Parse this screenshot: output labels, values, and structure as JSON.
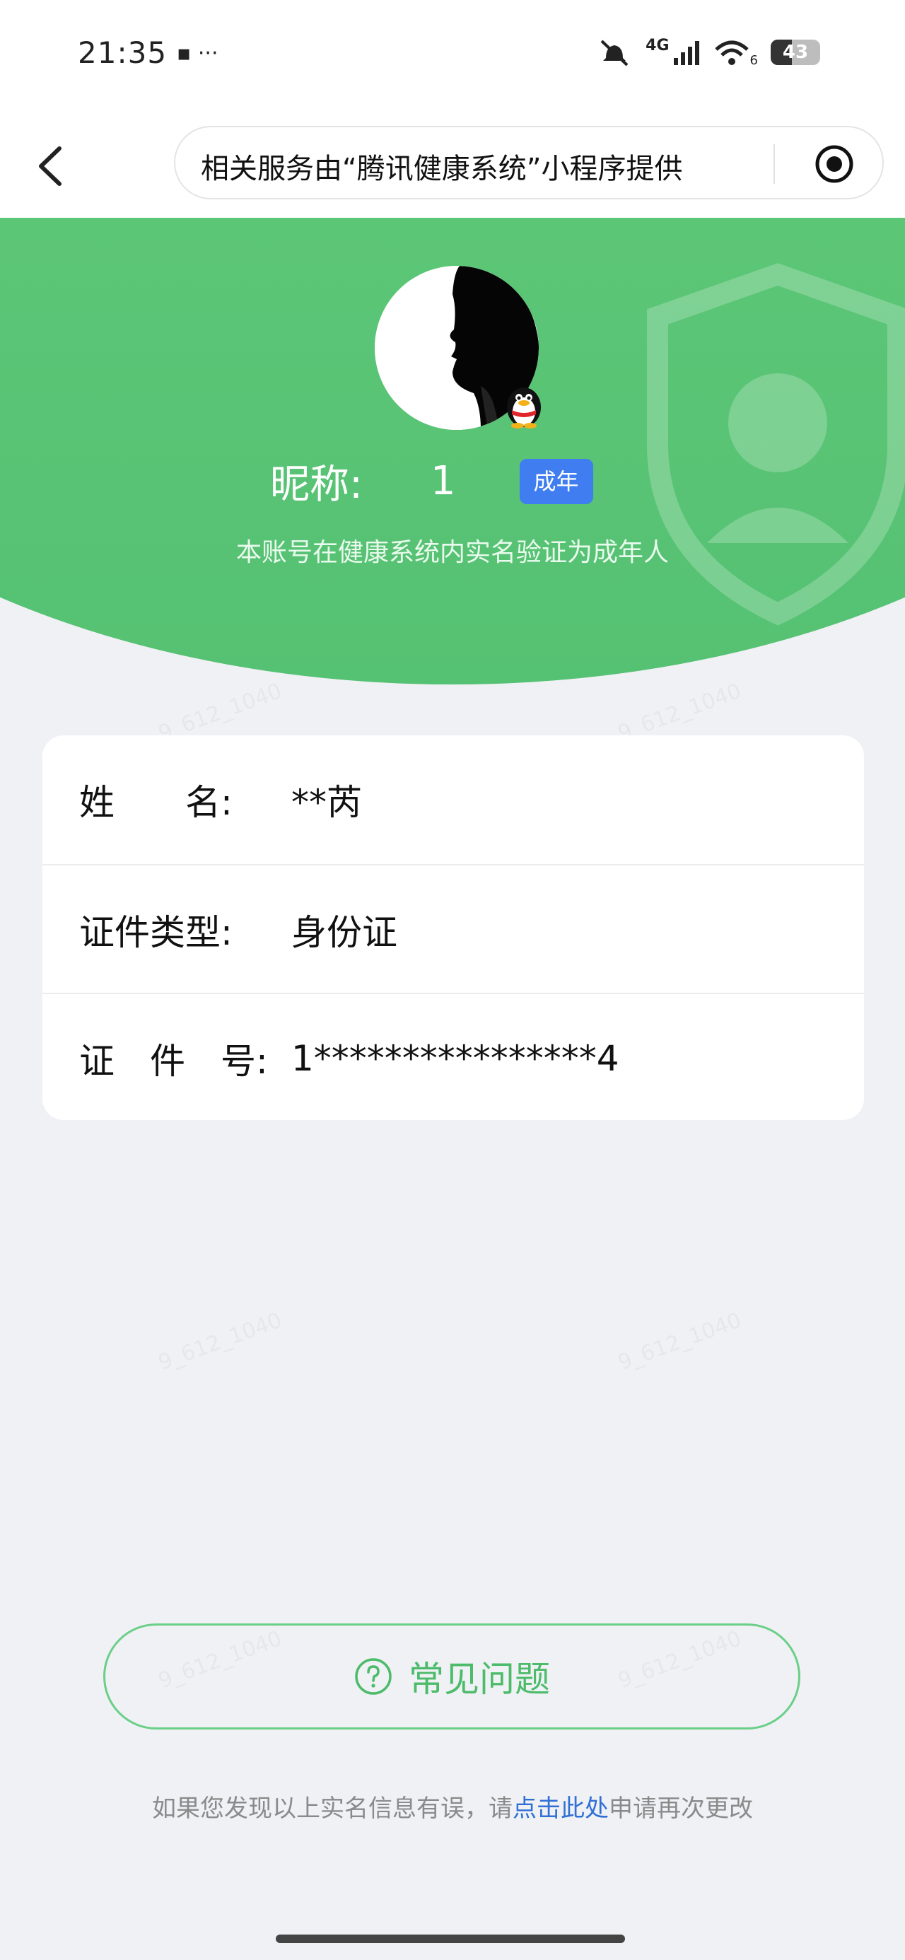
{
  "status_bar": {
    "time": "21:35",
    "extra": "▪ ···",
    "network": "4G",
    "wifi_sub": "6",
    "battery_level": "43",
    "battery_fraction": 0.43
  },
  "nav": {
    "capsule_text": "相关服务由“腾讯健康系统”小程序提供"
  },
  "profile": {
    "nickname_label": "昵称:",
    "nickname_value": "1",
    "badge": "成年",
    "verify_text": "本账号在健康系统内实名验证为成年人"
  },
  "info": {
    "rows": [
      {
        "label": "姓　　名:",
        "value": "**芮"
      },
      {
        "label": "证件类型:",
        "value": "身份证"
      },
      {
        "label": "证　件　号:",
        "value": "1****************4"
      }
    ]
  },
  "faq": {
    "label": "常见问题"
  },
  "notice": {
    "prefix": "如果您发现以上实名信息有误，请",
    "link": "点击此处",
    "suffix": "申请再次更改"
  },
  "watermark": "9_612_1040",
  "colors": {
    "green": "#5cc677",
    "badge_blue": "#3f7df0",
    "link_blue": "#2f6fd6"
  }
}
